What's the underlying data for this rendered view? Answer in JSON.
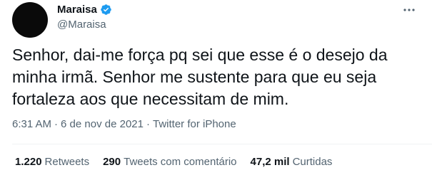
{
  "author": {
    "display_name": "Maraisa",
    "handle": "@Maraisa"
  },
  "tweet": {
    "text": "Senhor, dai-me força pq sei que esse é o desejo da minha irmã. Senhor me sustente para que eu seja fortaleza aos que necessitam de mim.",
    "time": "6:31 AM",
    "date": "6 de nov de 2021",
    "source": "Twitter for iPhone",
    "separator": "·"
  },
  "stats": {
    "retweets_count": "1.220",
    "retweets_label": "Retweets",
    "quotes_count": "290",
    "quotes_label": "Tweets com comentário",
    "likes_count": "47,2 mil",
    "likes_label": "Curtidas"
  },
  "icons": {
    "verified": "verified-badge-icon",
    "more": "more-options-icon"
  },
  "colors": {
    "verified_blue": "#1d9bf0",
    "secondary_text": "#536471",
    "primary_text": "#0f1419",
    "divider": "#eff3f4"
  }
}
